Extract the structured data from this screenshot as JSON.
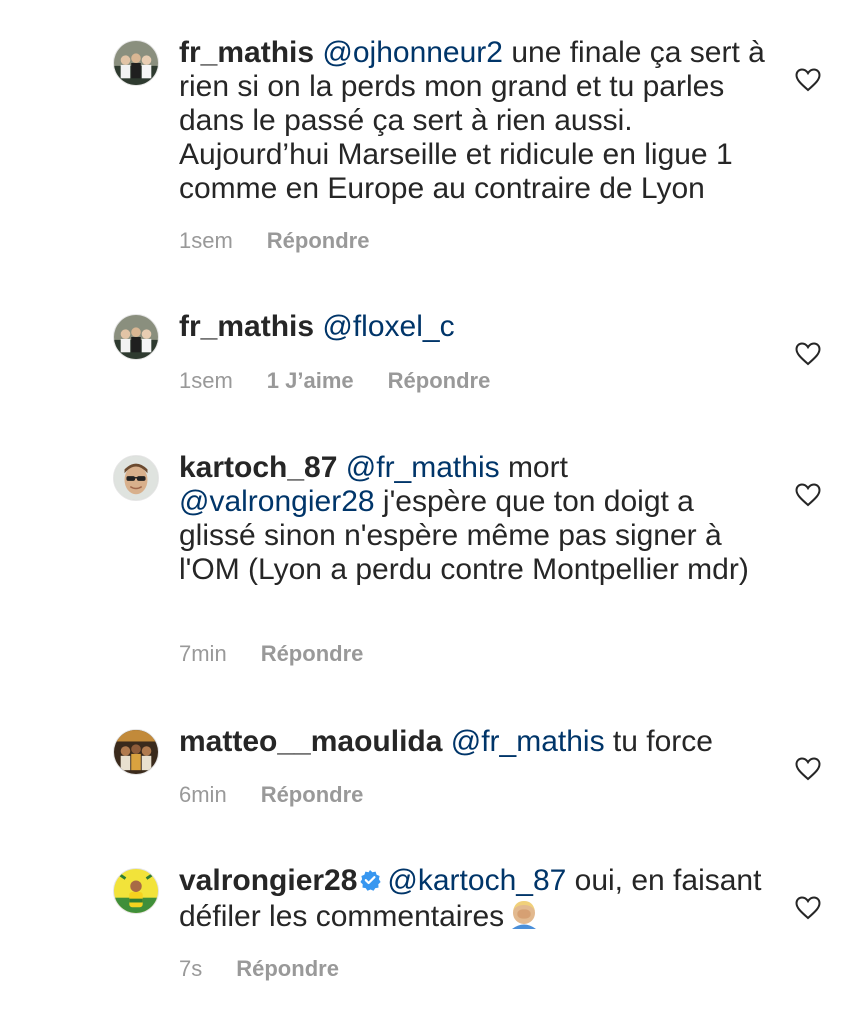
{
  "comments": [
    {
      "username": "fr_mathis",
      "mention": "@ojhonneur2",
      "text": " une finale ça sert à rien si on la perds mon grand et tu parles dans le passé ça sert à rien aussi. Aujourd’hui Marseille et ridicule en ligue 1 comme en Europe au contraire de Lyon",
      "time": "1sem",
      "reply_label": "Répondre"
    },
    {
      "username": "fr_mathis",
      "mention": "@floxel_c",
      "text": "",
      "time": "1sem",
      "likes_label": "1 J’aime",
      "reply_label": "Répondre"
    },
    {
      "username": "kartoch_87",
      "mention": "@fr_mathis",
      "text_a": " mort ",
      "mention2": "@valrongier28",
      "text_b": " j'espère que ton doigt a glissé sinon n'espère même pas signer à l'OM (Lyon a perdu contre Montpellier mdr)",
      "time": "7min",
      "reply_label": "Répondre"
    },
    {
      "username": "matteo__maoulida",
      "mention": "@fr_mathis",
      "text": " tu force",
      "time": "6min",
      "reply_label": "Répondre"
    },
    {
      "username": "valrongier28",
      "verified": true,
      "mention": "@kartoch_87",
      "text": " oui, en faisant défiler les commentaires",
      "emoji": "face-palm-emoji",
      "time": "7s",
      "reply_label": "Répondre"
    }
  ],
  "icons": {
    "like": "heart-outline-icon",
    "verified": "verified-badge-icon"
  },
  "colors": {
    "username": "#262626",
    "mention": "#003569",
    "meta": "#999999",
    "verified": "#3897f0"
  }
}
